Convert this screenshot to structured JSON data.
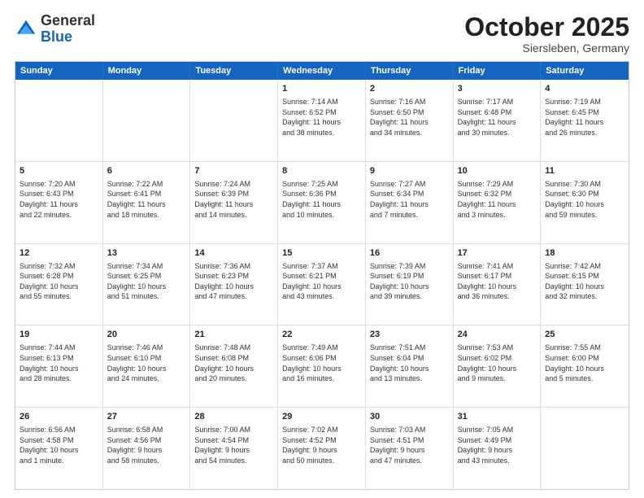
{
  "header": {
    "logo": {
      "general": "General",
      "blue": "Blue"
    },
    "title": "October 2025",
    "subtitle": "Siersleben, Germany"
  },
  "weekdays": [
    "Sunday",
    "Monday",
    "Tuesday",
    "Wednesday",
    "Thursday",
    "Friday",
    "Saturday"
  ],
  "rows": [
    [
      {
        "day": "",
        "info": ""
      },
      {
        "day": "",
        "info": ""
      },
      {
        "day": "",
        "info": ""
      },
      {
        "day": "1",
        "info": "Sunrise: 7:14 AM\nSunset: 6:52 PM\nDaylight: 11 hours\nand 38 minutes."
      },
      {
        "day": "2",
        "info": "Sunrise: 7:16 AM\nSunset: 6:50 PM\nDaylight: 11 hours\nand 34 minutes."
      },
      {
        "day": "3",
        "info": "Sunrise: 7:17 AM\nSunset: 6:48 PM\nDaylight: 11 hours\nand 30 minutes."
      },
      {
        "day": "4",
        "info": "Sunrise: 7:19 AM\nSunset: 6:45 PM\nDaylight: 11 hours\nand 26 minutes."
      }
    ],
    [
      {
        "day": "5",
        "info": "Sunrise: 7:20 AM\nSunset: 6:43 PM\nDaylight: 11 hours\nand 22 minutes."
      },
      {
        "day": "6",
        "info": "Sunrise: 7:22 AM\nSunset: 6:41 PM\nDaylight: 11 hours\nand 18 minutes."
      },
      {
        "day": "7",
        "info": "Sunrise: 7:24 AM\nSunset: 6:39 PM\nDaylight: 11 hours\nand 14 minutes."
      },
      {
        "day": "8",
        "info": "Sunrise: 7:25 AM\nSunset: 6:36 PM\nDaylight: 11 hours\nand 10 minutes."
      },
      {
        "day": "9",
        "info": "Sunrise: 7:27 AM\nSunset: 6:34 PM\nDaylight: 11 hours\nand 7 minutes."
      },
      {
        "day": "10",
        "info": "Sunrise: 7:29 AM\nSunset: 6:32 PM\nDaylight: 11 hours\nand 3 minutes."
      },
      {
        "day": "11",
        "info": "Sunrise: 7:30 AM\nSunset: 6:30 PM\nDaylight: 10 hours\nand 59 minutes."
      }
    ],
    [
      {
        "day": "12",
        "info": "Sunrise: 7:32 AM\nSunset: 6:28 PM\nDaylight: 10 hours\nand 55 minutes."
      },
      {
        "day": "13",
        "info": "Sunrise: 7:34 AM\nSunset: 6:25 PM\nDaylight: 10 hours\nand 51 minutes."
      },
      {
        "day": "14",
        "info": "Sunrise: 7:36 AM\nSunset: 6:23 PM\nDaylight: 10 hours\nand 47 minutes."
      },
      {
        "day": "15",
        "info": "Sunrise: 7:37 AM\nSunset: 6:21 PM\nDaylight: 10 hours\nand 43 minutes."
      },
      {
        "day": "16",
        "info": "Sunrise: 7:39 AM\nSunset: 6:19 PM\nDaylight: 10 hours\nand 39 minutes."
      },
      {
        "day": "17",
        "info": "Sunrise: 7:41 AM\nSunset: 6:17 PM\nDaylight: 10 hours\nand 36 minutes."
      },
      {
        "day": "18",
        "info": "Sunrise: 7:42 AM\nSunset: 6:15 PM\nDaylight: 10 hours\nand 32 minutes."
      }
    ],
    [
      {
        "day": "19",
        "info": "Sunrise: 7:44 AM\nSunset: 6:13 PM\nDaylight: 10 hours\nand 28 minutes."
      },
      {
        "day": "20",
        "info": "Sunrise: 7:46 AM\nSunset: 6:10 PM\nDaylight: 10 hours\nand 24 minutes."
      },
      {
        "day": "21",
        "info": "Sunrise: 7:48 AM\nSunset: 6:08 PM\nDaylight: 10 hours\nand 20 minutes."
      },
      {
        "day": "22",
        "info": "Sunrise: 7:49 AM\nSunset: 6:06 PM\nDaylight: 10 hours\nand 16 minutes."
      },
      {
        "day": "23",
        "info": "Sunrise: 7:51 AM\nSunset: 6:04 PM\nDaylight: 10 hours\nand 13 minutes."
      },
      {
        "day": "24",
        "info": "Sunrise: 7:53 AM\nSunset: 6:02 PM\nDaylight: 10 hours\nand 9 minutes."
      },
      {
        "day": "25",
        "info": "Sunrise: 7:55 AM\nSunset: 6:00 PM\nDaylight: 10 hours\nand 5 minutes."
      }
    ],
    [
      {
        "day": "26",
        "info": "Sunrise: 6:56 AM\nSunset: 4:58 PM\nDaylight: 10 hours\nand 1 minute."
      },
      {
        "day": "27",
        "info": "Sunrise: 6:58 AM\nSunset: 4:56 PM\nDaylight: 9 hours\nand 58 minutes."
      },
      {
        "day": "28",
        "info": "Sunrise: 7:00 AM\nSunset: 4:54 PM\nDaylight: 9 hours\nand 54 minutes."
      },
      {
        "day": "29",
        "info": "Sunrise: 7:02 AM\nSunset: 4:52 PM\nDaylight: 9 hours\nand 50 minutes."
      },
      {
        "day": "30",
        "info": "Sunrise: 7:03 AM\nSunset: 4:51 PM\nDaylight: 9 hours\nand 47 minutes."
      },
      {
        "day": "31",
        "info": "Sunrise: 7:05 AM\nSunset: 4:49 PM\nDaylight: 9 hours\nand 43 minutes."
      },
      {
        "day": "",
        "info": ""
      }
    ]
  ]
}
